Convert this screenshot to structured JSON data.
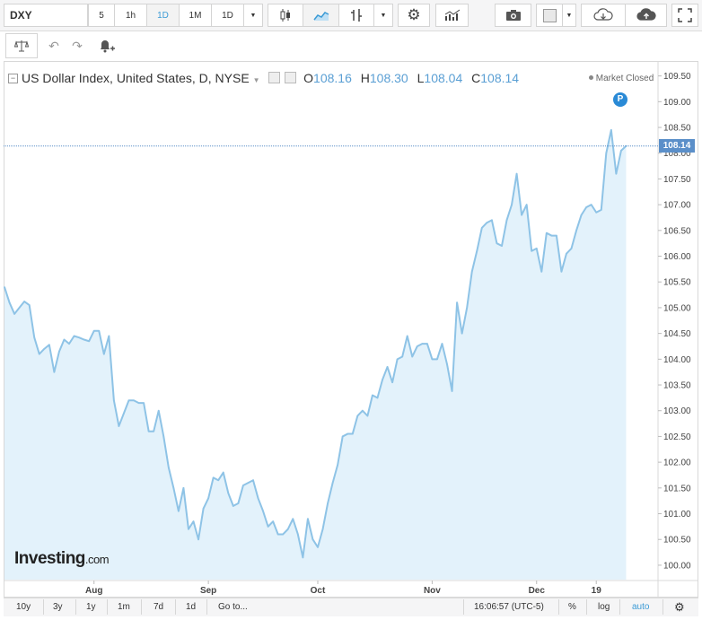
{
  "toolbar": {
    "symbol": "DXY",
    "intervals": [
      "5",
      "1h",
      "1D",
      "1M",
      "1D"
    ],
    "active_interval_index": 2,
    "icons": [
      "dropdown-icon",
      "candles-icon",
      "area-chart-icon",
      "indicators-icon",
      "dropdown-icon",
      "settings-icon",
      "studies-icon",
      "camera-icon",
      "box-icon",
      "dropdown-icon",
      "cloud-download-icon",
      "cloud-upload-icon",
      "fullscreen-icon"
    ]
  },
  "toolbar2": {
    "icons": [
      "scale-icon",
      "undo-icon",
      "redo-icon",
      "alert-add-icon"
    ]
  },
  "legend": {
    "title": "US Dollar Index, United States, D, NYSE",
    "o_label": "O",
    "o_value": "108.16",
    "h_label": "H",
    "h_value": "108.30",
    "l_label": "L",
    "l_value": "108.04",
    "c_label": "C",
    "c_value": "108.14",
    "market_status": "Market Closed"
  },
  "badge": "P",
  "brand": {
    "name": "Investing",
    "suffix": ".com"
  },
  "colors": {
    "line": "#8ec3e6",
    "fill": "#e3f2fb",
    "accent": "#3c9bd6",
    "last_price": "#5b8fc9"
  },
  "chart_data": {
    "type": "area",
    "y_axis_labels": [
      "109.50",
      "109.00",
      "108.50",
      "108.00",
      "107.50",
      "107.00",
      "106.50",
      "106.00",
      "105.50",
      "105.00",
      "104.50",
      "104.00",
      "103.50",
      "103.00",
      "102.50",
      "102.00",
      "101.50",
      "101.00",
      "100.50",
      "100.00"
    ],
    "ylim": [
      99.72,
      109.72
    ],
    "x_axis_labels": [
      {
        "label": "Aug",
        "x": 18
      },
      {
        "label": "Sep",
        "x": 41
      },
      {
        "label": "Oct",
        "x": 63
      },
      {
        "label": "Nov",
        "x": 86
      },
      {
        "label": "Dec",
        "x": 107
      },
      {
        "label": "19",
        "x": 119
      }
    ],
    "xlim": [
      0,
      126
    ],
    "last_price": "108.14",
    "values": [
      105.4,
      105.1,
      104.88,
      105.0,
      105.12,
      105.05,
      104.42,
      104.1,
      104.2,
      104.28,
      103.75,
      104.15,
      104.38,
      104.3,
      104.45,
      104.42,
      104.38,
      104.35,
      104.55,
      104.55,
      104.1,
      104.45,
      103.2,
      102.7,
      102.95,
      103.2,
      103.2,
      103.15,
      103.15,
      102.6,
      102.6,
      103.0,
      102.5,
      101.9,
      101.5,
      101.05,
      101.5,
      100.7,
      100.85,
      100.5,
      101.1,
      101.3,
      101.7,
      101.65,
      101.8,
      101.4,
      101.15,
      101.2,
      101.55,
      101.6,
      101.65,
      101.3,
      101.05,
      100.75,
      100.85,
      100.6,
      100.6,
      100.7,
      100.9,
      100.6,
      100.15,
      100.9,
      100.5,
      100.35,
      100.7,
      101.2,
      101.6,
      101.95,
      102.5,
      102.55,
      102.55,
      102.9,
      103.0,
      102.9,
      103.3,
      103.25,
      103.6,
      103.85,
      103.55,
      104.0,
      104.05,
      104.45,
      104.05,
      104.25,
      104.3,
      104.3,
      104.0,
      104.0,
      104.3,
      103.9,
      103.38,
      105.1,
      104.5,
      105.0,
      105.7,
      106.1,
      106.55,
      106.65,
      106.7,
      106.25,
      106.2,
      106.7,
      107.0,
      107.6,
      106.8,
      107.0,
      106.1,
      106.15,
      105.7,
      106.45,
      106.4,
      106.4,
      105.7,
      106.05,
      106.15,
      106.5,
      106.8,
      106.95,
      107.0,
      106.85,
      106.9,
      108.0,
      108.45,
      107.6,
      108.05,
      108.14
    ]
  },
  "bottom": {
    "ranges": [
      "10y",
      "3y",
      "1y",
      "1m",
      "7d",
      "1d"
    ],
    "goto": "Go to...",
    "time": "16:06:57 (UTC-5)",
    "pct": "%",
    "log": "log",
    "auto": "auto"
  }
}
